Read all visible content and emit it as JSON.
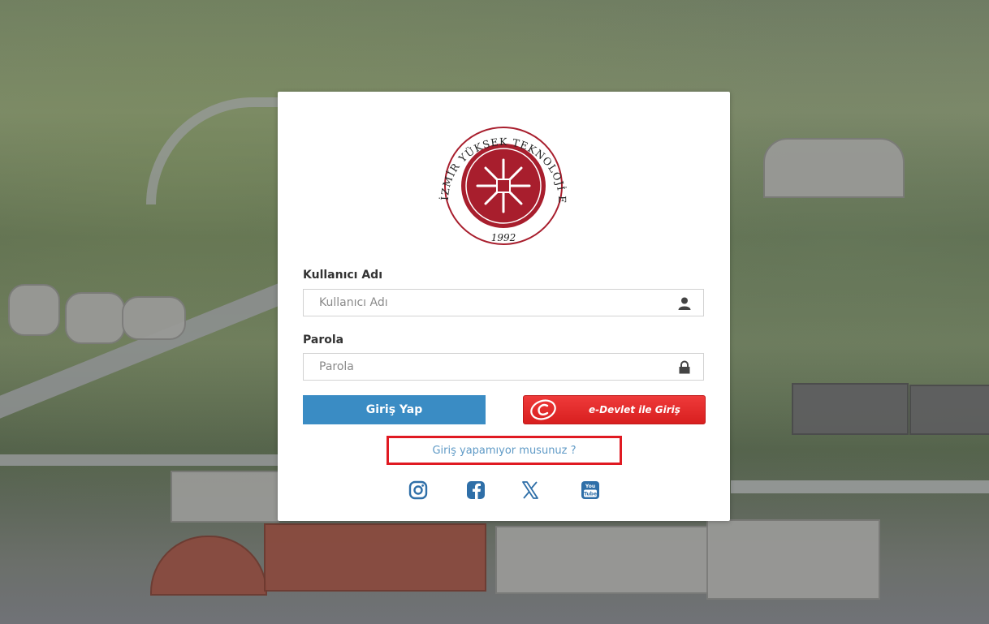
{
  "logo": {
    "arc_text": "İZMİR YÜKSEK TEKNOLOJİ ENSTİTÜSÜ",
    "year": "1992",
    "color": "#a81e2d"
  },
  "login": {
    "username_label": "Kullanıcı Adı",
    "username_placeholder": "Kullanıcı Adı",
    "username_value": "",
    "password_label": "Parola",
    "password_placeholder": "Parola",
    "password_value": "",
    "submit_label": "Giriş Yap",
    "edevlet_label": "e-Devlet ile Giriş",
    "help_link": "Giriş yapamıyor musunuz ?"
  },
  "social": {
    "icons": [
      "instagram-icon",
      "facebook-icon",
      "x-twitter-icon",
      "youtube-icon"
    ],
    "youtube_text": "You Tube",
    "color": "#2f6fa8"
  },
  "colors": {
    "primary_button": "#3a8cc4",
    "edevlet_button": "#e02b2b",
    "help_highlight": "#e01a22",
    "link": "#5f9ac6"
  }
}
